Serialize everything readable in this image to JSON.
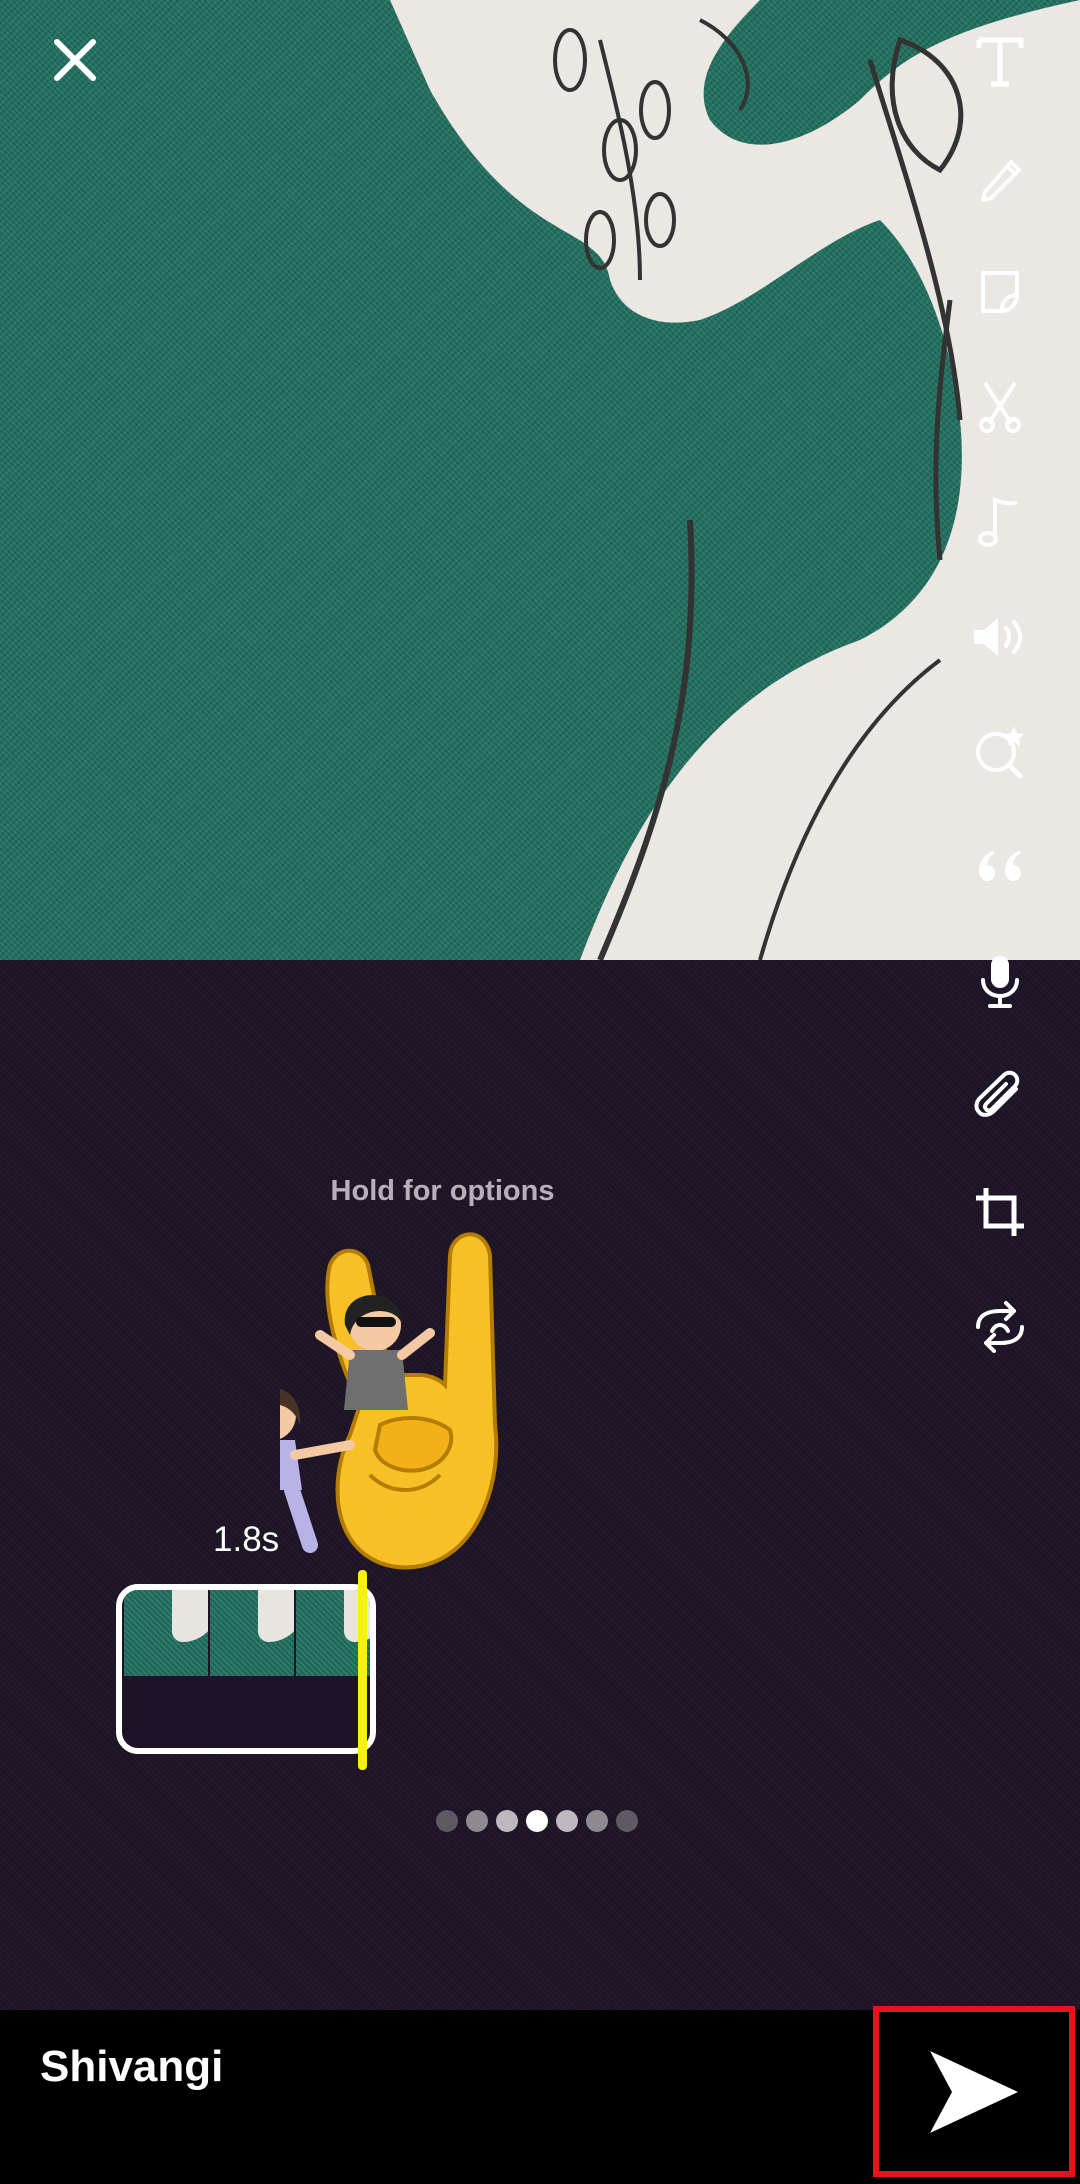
{
  "editor": {
    "hint": "Hold for options",
    "clip_duration": "1.8s"
  },
  "toolbar": {
    "items": [
      "text-tool",
      "draw-tool",
      "sticker-tool",
      "scissors-tool",
      "music-tool",
      "sound-tool",
      "lens-tool",
      "quote-tool",
      "voice-tool",
      "attachment-tool",
      "crop-tool",
      "loop-tool"
    ]
  },
  "page_indicator": {
    "count": 7,
    "active": 4
  },
  "footer": {
    "recipient": "Shivangi"
  },
  "colors": {
    "playhead": "#f5f20c",
    "highlight": "#e4141b",
    "background": "#1d1426"
  }
}
